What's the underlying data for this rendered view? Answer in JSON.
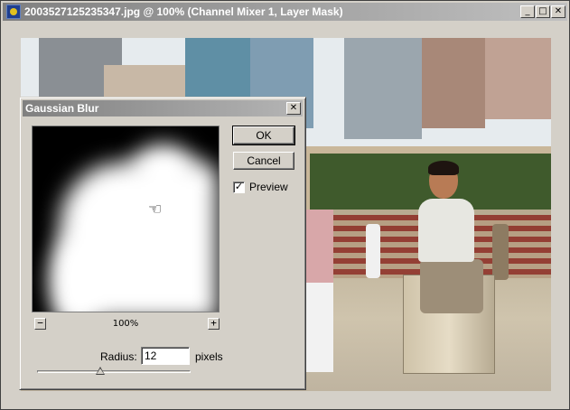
{
  "window": {
    "title": "2003527125235347.jpg @ 100% (Channel Mixer 1, Layer Mask)",
    "minimize": "_",
    "maximize": "□",
    "close": "✕",
    "icon": "photoshop-app-icon"
  },
  "dialog": {
    "title": "Gaussian Blur",
    "close": "✕",
    "ok_label": "OK",
    "cancel_label": "Cancel",
    "preview_label": "Preview",
    "preview_checked": true,
    "check_mark": "✓",
    "zoom_out": "−",
    "zoom_in": "+",
    "zoom_level": "100%",
    "radius_label": "Radius:",
    "radius_value": "12",
    "radius_unit": "pixels",
    "radius_slider_fraction": 0.41,
    "hand_icon": "☜"
  }
}
